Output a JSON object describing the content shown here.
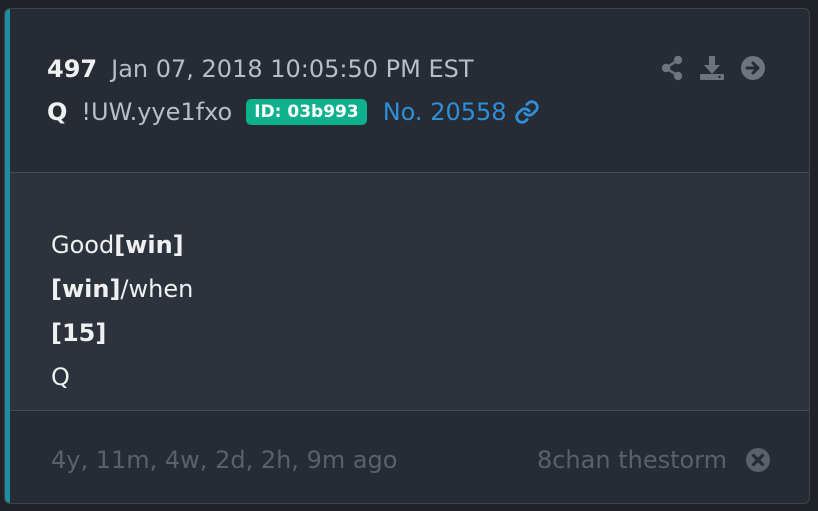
{
  "post": {
    "number": "497",
    "date": "Jan 07, 2018 10:05:50 PM EST",
    "author": "Q",
    "tripcode": "!UW.yye1fxo",
    "id_badge": "ID: 03b993",
    "post_link": "No. 20558"
  },
  "message": {
    "line1_text": "Good",
    "line1_bold": "[win]",
    "line2_bold": "[win]",
    "line2_text": "/when",
    "line3_bold": "[15]",
    "line4_text": "Q"
  },
  "footer": {
    "age": "4y, 11m, 4w, 2d, 2h, 9m ago",
    "board": "8chan thestorm"
  },
  "icons": {
    "share": "share-icon",
    "download": "download-icon",
    "go": "arrow-right-circle-icon",
    "link": "link-icon",
    "close": "close-circle-icon"
  },
  "colors": {
    "background": "#1f2328",
    "card": "#272b33",
    "body": "#2d333c",
    "accent": "#1c8ea0",
    "id_badge": "#0fb08d",
    "link": "#2e8fd8",
    "muted": "#5a6169"
  }
}
